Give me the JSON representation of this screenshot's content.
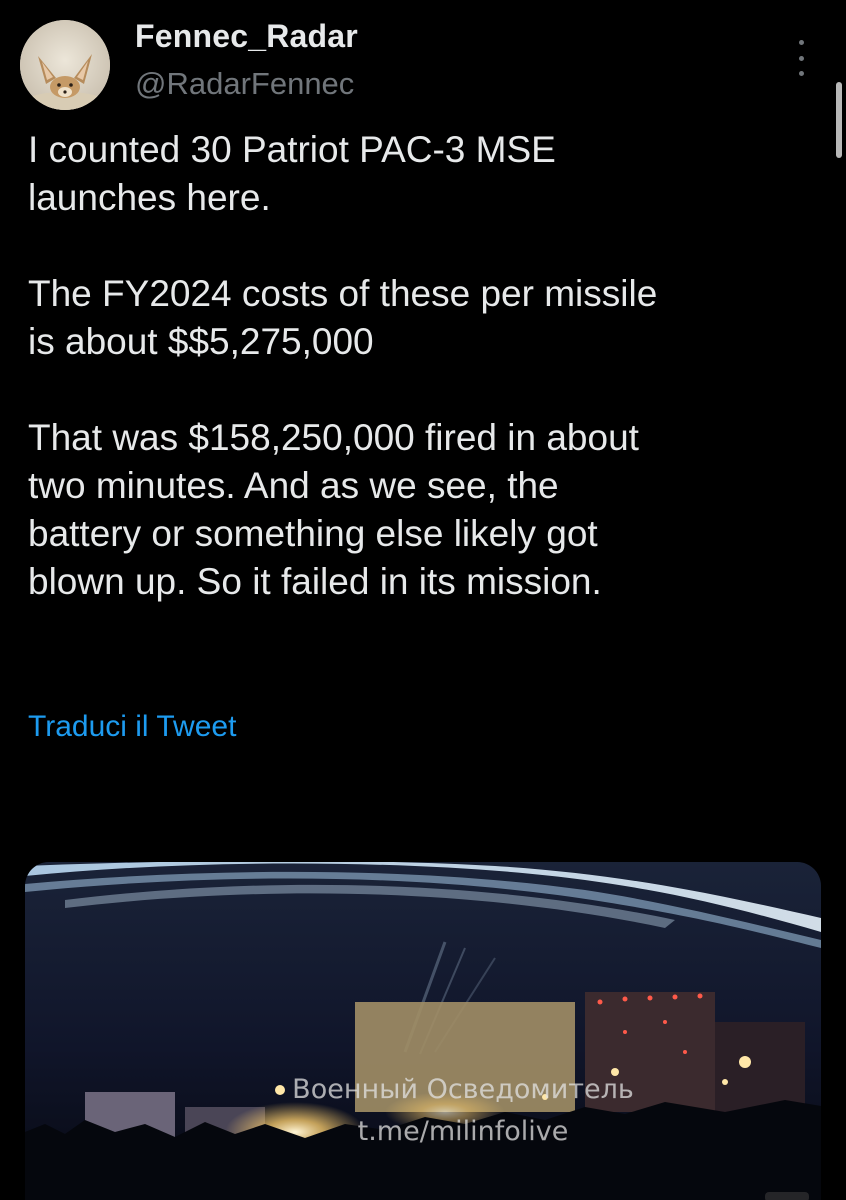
{
  "author": {
    "display_name": "Fennec_Radar",
    "handle": "@RadarFennec"
  },
  "tweet": {
    "paragraphs": [
      "I counted 30 Patriot PAC-3 MSE\nlaunches here.",
      "The FY2024 costs of these per missile\nis about $$5,275,000",
      "That was $158,250,000 fired in about\ntwo minutes. And as we see, the\nbattery or something else likely got\nblown up. So it failed in its mission."
    ],
    "translate_label": "Traduci il Tweet"
  },
  "media": {
    "watermark_line1": "Военный Осведомитель",
    "watermark_line2": "t.me/milinfolive"
  },
  "colors": {
    "background": "#000000",
    "text": "#e7e9ea",
    "secondary": "#71767b",
    "link": "#1d9bf0"
  },
  "icons": {
    "more": "more-vertical-icon",
    "avatar": "fennec-fox-avatar"
  }
}
